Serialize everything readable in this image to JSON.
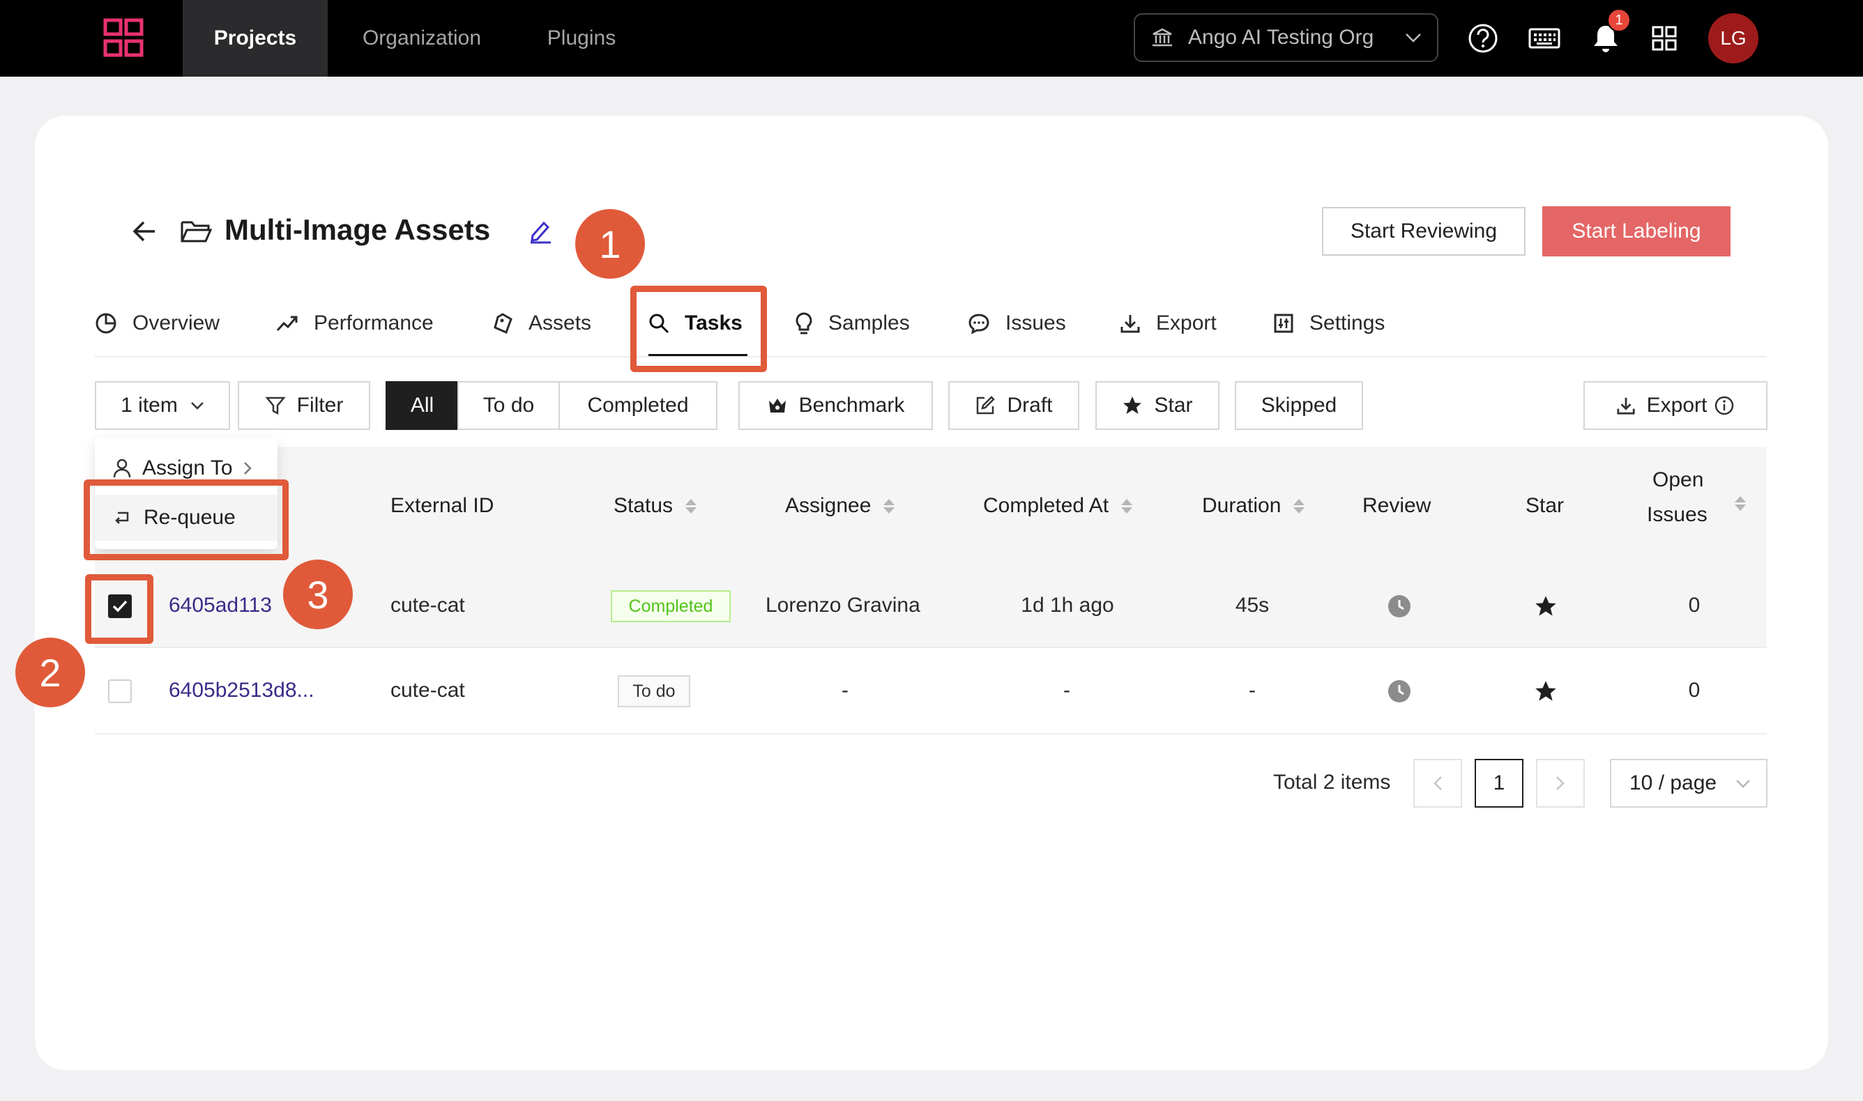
{
  "nav": {
    "tabs": [
      "Projects",
      "Organization",
      "Plugins"
    ],
    "org_name": "Ango AI Testing Org",
    "notification_count": "1",
    "avatar_initials": "LG"
  },
  "project": {
    "title": "Multi-Image Assets",
    "start_reviewing": "Start Reviewing",
    "start_labeling": "Start Labeling"
  },
  "tabs": [
    "Overview",
    "Performance",
    "Assets",
    "Tasks",
    "Samples",
    "Issues",
    "Export",
    "Settings"
  ],
  "toolbar": {
    "selection": "1 item",
    "filter": "Filter",
    "status_filters": [
      "All",
      "To do",
      "Completed"
    ],
    "benchmark": "Benchmark",
    "draft": "Draft",
    "star": "Star",
    "skipped": "Skipped",
    "export": "Export"
  },
  "dropdown": {
    "assign_to": "Assign To",
    "requeue": "Re-queue"
  },
  "table": {
    "columns": [
      "External ID",
      "Status",
      "Assignee",
      "Completed At",
      "Duration",
      "Review",
      "Star",
      "Open",
      "Issues"
    ],
    "rows": [
      {
        "id": "6405ad113",
        "external_id": "cute-cat",
        "status": "Completed",
        "assignee": "Lorenzo Gravina",
        "completed_at": "1d 1h ago",
        "duration": "45s",
        "open_issues": "0",
        "checked": true
      },
      {
        "id": "6405b2513d8...",
        "external_id": "cute-cat",
        "status": "To do",
        "assignee": "-",
        "completed_at": "-",
        "duration": "-",
        "open_issues": "0",
        "checked": false
      }
    ]
  },
  "pagination": {
    "total": "Total 2 items",
    "current_page": "1",
    "page_size": "10 / page"
  },
  "callouts": [
    "1",
    "2",
    "3"
  ],
  "colors": {
    "accent": "#e05a3a",
    "primary_button": "#e46666",
    "status_completed": "#52c41a"
  }
}
